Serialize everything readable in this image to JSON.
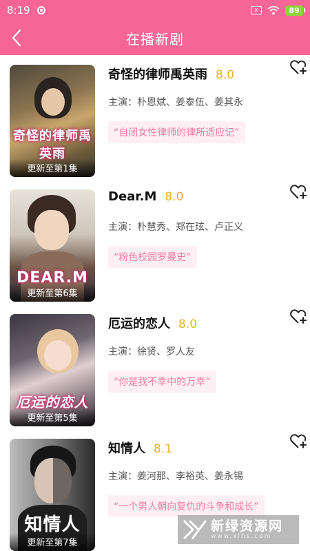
{
  "status_bar": {
    "time": "8:19",
    "battery": "89",
    "sim_label": "x"
  },
  "header": {
    "title": "在播新剧"
  },
  "shows": [
    {
      "title": "奇怪的律师禹英雨",
      "rating": "8.0",
      "cast": "主演：朴恩斌、姜泰伍、姜其永",
      "tagline": "“自闭女性律师的律所适应记”",
      "poster_title": "奇怪的律师禹英雨",
      "update_label": "更新至第1集",
      "poster_colors": [
        "#6b5a3a",
        "#c9a66b",
        "#3d3a35"
      ]
    },
    {
      "title": "Dear.M",
      "rating": "8.0",
      "cast": "主演：朴慧秀、郑在玹、卢正义",
      "tagline": "“粉色校园罗曼史”",
      "poster_title": "DEAR.M",
      "update_label": "更新至第6集",
      "poster_colors": [
        "#d9d2c9",
        "#8b6b55",
        "#3c3a4a"
      ]
    },
    {
      "title": "厄运的恋人",
      "rating": "8.0",
      "cast": "主演：徐贤、罗人友",
      "tagline": "“你是我不幸中的万幸”",
      "poster_title": "厄运的恋人",
      "update_label": "更新至第5集",
      "poster_colors": [
        "#5c5660",
        "#d9c7c9",
        "#2e2b33"
      ]
    },
    {
      "title": "知情人",
      "rating": "8.1",
      "cast": "主演：姜河那、李裕英、姜永锡",
      "tagline": "“一个男人朝向复仇的斗争和成长”",
      "poster_title": "知情人",
      "update_label": "更新至第7集",
      "poster_colors": [
        "#a9a9a9",
        "#4a4a4a",
        "#1d1d1d"
      ]
    }
  ],
  "watermark": {
    "text": "新绿资源网",
    "url": "www.xlhs.com"
  },
  "colors": {
    "brand_pink": "#f76596",
    "rating_gold": "#e9b22c",
    "tag_bg": "#fdeff4",
    "tag_text": "#f27aa3"
  }
}
